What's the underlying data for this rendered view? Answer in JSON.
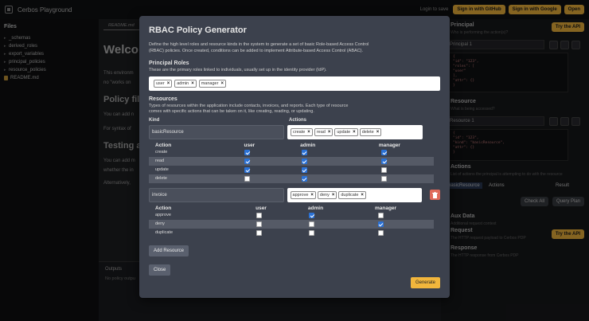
{
  "app": {
    "title": "Cerbos Playground"
  },
  "topbar": {
    "login_text": "Login to save",
    "github_label": "Sign in with GitHub",
    "google_label": "Sign in with Google",
    "open_label": "Open"
  },
  "sidebar": {
    "title": "Files",
    "items": [
      {
        "label": "_schemas",
        "type": "folder"
      },
      {
        "label": "derived_roles",
        "type": "folder"
      },
      {
        "label": "export_variables",
        "type": "folder"
      },
      {
        "label": "principal_policies",
        "type": "folder"
      },
      {
        "label": "resource_policies",
        "type": "folder"
      },
      {
        "label": "README.md",
        "type": "file"
      }
    ]
  },
  "editor": {
    "tab": "README.md",
    "heading": "Welco",
    "line1": "This environm",
    "line2": "no \"works on",
    "h2a": "Policy file",
    "p_a1": "You can add n",
    "p_a2": "For syntax of",
    "h2b": "Testing ac",
    "p_b1": "You can add m",
    "p_b2": "whether the in",
    "p_b3": "Alternatively,"
  },
  "outputs": {
    "tab": "Outputs",
    "text": "No policy outpu"
  },
  "right_panel": {
    "principal_title": "Principal",
    "principal_sub": "Who is performing the action(s)?",
    "principal_select": "Principal 1",
    "try_api": "Try the API",
    "resource_title": "Resource",
    "resource_sub": "What is being accessed?",
    "resource_select": "Resource 1",
    "actions_title": "Actions",
    "actions_sub": "List of actions the principal is attempting to do with the resource",
    "col_resource": "basicResource",
    "col_actions": "Actions",
    "col_result": "Result",
    "check_all": "Check All",
    "query_plan": "Query Plan",
    "aux_title": "Aux Data",
    "aux_sub": "Additional request context",
    "request_title": "Request",
    "request_sub": "The HTTP request payload to Cerbos PDP",
    "try_api2": "Try the API",
    "response_title": "Response",
    "response_sub": "The HTTP response from Cerbos PDP",
    "code1": [
      "{",
      "  \"id\": \"123\",",
      "  \"roles\": [",
      "    \"user\"",
      "  ],",
      "  \"attr\": {}",
      "}"
    ],
    "code2": [
      "{",
      "  \"id\": \"123\",",
      "  \"kind\": \"basicResource\",",
      "  \"attr\": {}",
      "}"
    ]
  },
  "modal": {
    "title": "RBAC Policy Generator",
    "intro": "Define the high level roles and resource kinds in the system to generate a set of basic Role-based Access Control (RBAC) policies. Once created, conditions can be added to implement Attribute-based Access Control (ABAC).",
    "principal_roles_title": "Principal Roles",
    "principal_roles_desc": "These are the primary roles linked to individuals, usually set up in the identity provider (IdP).",
    "roles": [
      "user",
      "admin",
      "manager"
    ],
    "resources_title": "Resources",
    "resources_desc": "Types of resources within the application include contacts, invoices, and reports. Each type of resource comes with specific actions that can be taken on it, like creating, reading, or updating.",
    "kind_label": "Kind",
    "actions_label": "Actions",
    "action_col": "Action",
    "resources": [
      {
        "kind": "basicResource",
        "actions": [
          "create",
          "read",
          "update",
          "delete"
        ],
        "matrix": [
          {
            "action": "create",
            "user": true,
            "admin": true,
            "manager": true
          },
          {
            "action": "read",
            "user": true,
            "admin": true,
            "manager": true
          },
          {
            "action": "update",
            "user": true,
            "admin": true,
            "manager": false
          },
          {
            "action": "delete",
            "user": false,
            "admin": true,
            "manager": false
          }
        ]
      },
      {
        "kind": "invoice",
        "actions": [
          "approve",
          "deny",
          "duplicate"
        ],
        "matrix": [
          {
            "action": "approve",
            "user": false,
            "admin": true,
            "manager": false
          },
          {
            "action": "deny",
            "user": false,
            "admin": false,
            "manager": true
          },
          {
            "action": "duplicate",
            "user": false,
            "admin": false,
            "manager": false
          }
        ]
      }
    ],
    "add_resource": "Add Resource",
    "close": "Close",
    "generate": "Generate"
  }
}
